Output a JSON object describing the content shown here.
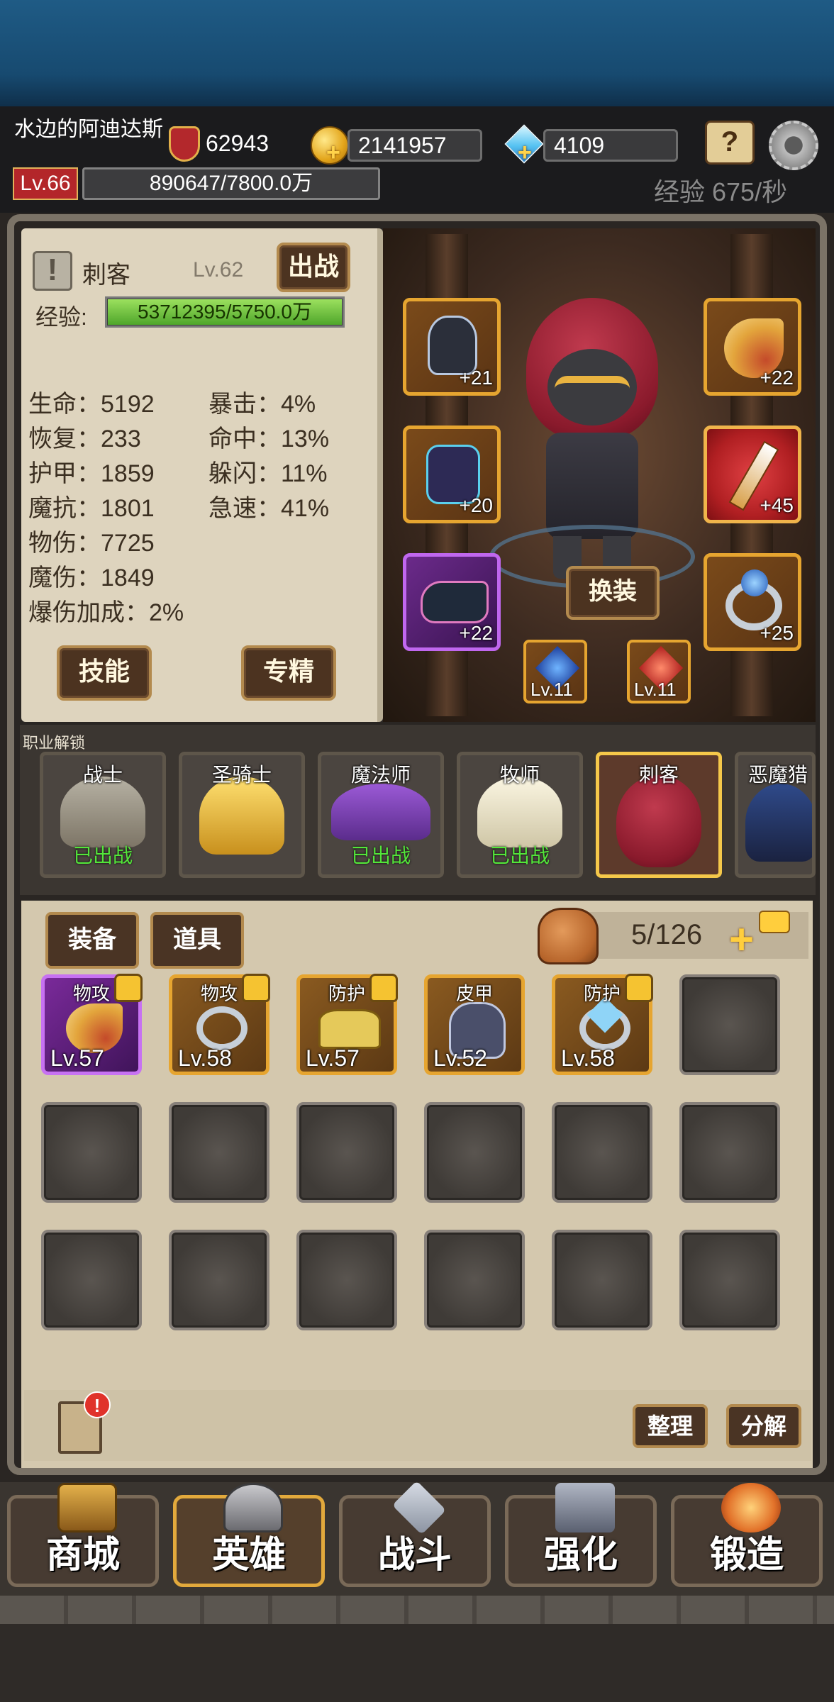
{
  "header": {
    "player_name": "水边的阿迪达斯",
    "power": "62943",
    "gold": "2141957",
    "gems": "4109",
    "level": "Lv.66",
    "xp": "890647/7800.0万",
    "xp_rate": "经验 675/秒"
  },
  "hero": {
    "class_name": "刺客",
    "level": "Lv.62",
    "deploy_label": "出战",
    "xp_label": "经验:",
    "xp_value": "53712395/5750.0万",
    "stats_left": [
      "生命：5192",
      "恢复：233",
      "护甲：1859",
      "魔抗：1801",
      "物伤：7725",
      "魔伤：1849",
      "爆伤加成：2%"
    ],
    "stats_right": [
      "暴击：4%",
      "命中：13%",
      "躲闪：11%",
      "急速：41%"
    ],
    "skill_label": "技能",
    "specialize_label": "专精"
  },
  "equipment": {
    "slots": [
      {
        "name": "helmet",
        "plus": "+21"
      },
      {
        "name": "armor",
        "plus": "+20"
      },
      {
        "name": "boots",
        "plus": "+22"
      },
      {
        "name": "horn",
        "plus": "+22"
      },
      {
        "name": "weapon",
        "plus": "+45"
      },
      {
        "name": "ring",
        "plus": "+25"
      }
    ],
    "gem_slots": [
      {
        "lv": "Lv.11"
      },
      {
        "lv": "Lv.11"
      }
    ],
    "swap_label": "换装"
  },
  "jobs": {
    "title": "职业解锁",
    "cards": [
      {
        "name": "战士",
        "status": "已出战"
      },
      {
        "name": "圣骑士",
        "status": ""
      },
      {
        "name": "魔法师",
        "status": "已出战"
      },
      {
        "name": "牧师",
        "status": "已出战"
      },
      {
        "name": "刺客",
        "status": ""
      },
      {
        "name": "恶魔猎",
        "status": ""
      }
    ]
  },
  "inventory": {
    "tab_equipment": "装备",
    "tab_items": "道具",
    "count": "5/126",
    "items": [
      {
        "type": "物攻",
        "lv": "Lv.57"
      },
      {
        "type": "物攻",
        "lv": "Lv.58"
      },
      {
        "type": "防护",
        "lv": "Lv.57"
      },
      {
        "type": "皮甲",
        "lv": "Lv.52"
      },
      {
        "type": "防护",
        "lv": "Lv.58"
      }
    ],
    "sort_label": "整理",
    "decompose_label": "分解",
    "badge": "!"
  },
  "nav": {
    "shop": "商城",
    "hero": "英雄",
    "battle": "战斗",
    "enhance": "强化",
    "forge": "锻造"
  },
  "colors": {
    "gold_border": "#e6a530",
    "epic_purple": "#c772f2",
    "deployed_green": "#53e63a",
    "level_red": "#b3262a"
  }
}
